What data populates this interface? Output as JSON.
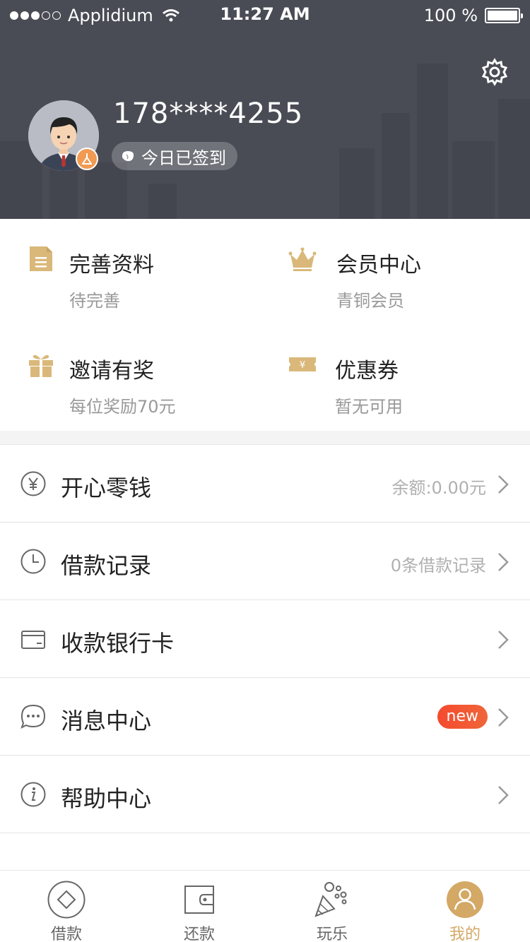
{
  "status_bar": {
    "carrier": "Applidium",
    "time": "11:27 AM",
    "battery": "100 %"
  },
  "profile": {
    "phone": "178****4255",
    "checkin": "今日已签到"
  },
  "grid": [
    {
      "title": "完善资料",
      "subtitle": "待完善",
      "icon": "document-icon"
    },
    {
      "title": "会员中心",
      "subtitle": "青铜会员",
      "icon": "crown-icon"
    },
    {
      "title": "邀请有奖",
      "subtitle": "每位奖励70元",
      "icon": "gift-icon"
    },
    {
      "title": "优惠券",
      "subtitle": "暂无可用",
      "icon": "coupon-icon"
    }
  ],
  "list": [
    {
      "label": "开心零钱",
      "extra": "余额:0.00元",
      "icon": "yen-circle-icon"
    },
    {
      "label": "借款记录",
      "extra": "0条借款记录",
      "icon": "clock-icon"
    },
    {
      "label": "收款银行卡",
      "extra": "",
      "icon": "card-icon"
    },
    {
      "label": "消息中心",
      "badge": "new",
      "icon": "chat-icon"
    },
    {
      "label": "帮助中心",
      "extra": "",
      "icon": "info-icon"
    }
  ],
  "tabs": [
    {
      "label": "借款",
      "icon": "diamond-icon"
    },
    {
      "label": "还款",
      "icon": "wallet-icon"
    },
    {
      "label": "玩乐",
      "icon": "party-icon"
    },
    {
      "label": "我的",
      "icon": "user-icon",
      "active": true
    }
  ],
  "colors": {
    "header_bg": "#4a4c55",
    "accent_gold": "#d4a865",
    "badge_red": "#f44a2e"
  }
}
